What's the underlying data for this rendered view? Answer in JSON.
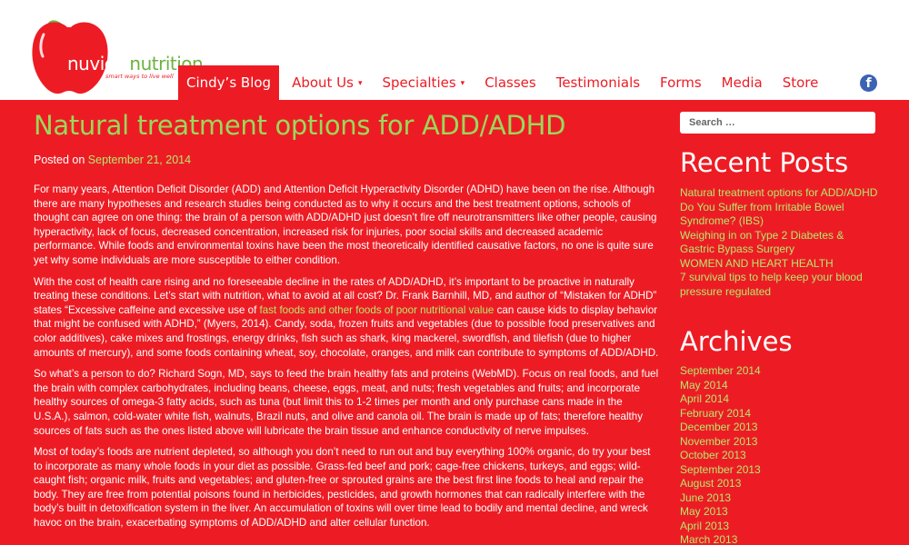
{
  "logo": {
    "word_white": "nuview",
    "word_green": "nutrition",
    "tagline": "smart ways to live well"
  },
  "nav": {
    "items": [
      {
        "label": "Cindy’s Blog",
        "dropdown": false,
        "active": true
      },
      {
        "label": "About Us",
        "dropdown": true,
        "active": false
      },
      {
        "label": "Specialties",
        "dropdown": true,
        "active": false
      },
      {
        "label": "Classes",
        "dropdown": false,
        "active": false
      },
      {
        "label": "Testimonials",
        "dropdown": false,
        "active": false
      },
      {
        "label": "Forms",
        "dropdown": false,
        "active": false
      },
      {
        "label": "Media",
        "dropdown": false,
        "active": false
      },
      {
        "label": "Store",
        "dropdown": false,
        "active": false
      }
    ],
    "caret": "▾",
    "social_icon": "facebook-icon",
    "social_glyph": "f"
  },
  "colors": {
    "brand_red": "#ed1c24",
    "brand_green": "#6cb33f",
    "title_green": "#9bd85a",
    "link_green": "#b5e86e",
    "facebook_blue": "#3b63b3"
  },
  "article": {
    "title": "Natural treatment options for ADD/ADHD",
    "posted_on_label": "Posted on",
    "posted_date": "September 21, 2014",
    "p1": "For many years, Attention Deficit Disorder (ADD) and Attention Deficit Hyperactivity Disorder (ADHD) have been on the rise. Although there are many hypotheses and research studies being conducted as to why it occurs and the best treatment options, schools of thought can agree on one thing: the brain of a person with ADD/ADHD just doesn’t fire off neurotransmitters like other people, causing hyperactivity, lack of focus, decreased concentration, increased risk for injuries, poor social skills and decreased academic performance.  While foods and environmental toxins have been the most theoretically identified causative factors, no one is quite sure yet why some individuals are more susceptible to either condition.",
    "p2_before_link": "With the cost of health care rising and no foreseeable decline in the rates of ADD/ADHD, it’s important to be proactive in naturally treating these conditions. Let’s start with nutrition, what to avoid at all cost?  Dr. Frank Barnhill, MD, and author of “Mistaken for ADHD” states “Excessive caffeine and excessive use of ",
    "p2_link": "fast foods and other foods of poor nutritional value",
    "p2_after_link": " can cause kids to display behavior that might be confused with ADHD,” (Myers, 2014). Candy, soda, frozen fruits and vegetables (due to possible food preservatives and color additives), cake mixes and frostings, energy drinks, fish such as shark, king mackerel, swordfish, and tilefish (due to higher amounts of mercury), and some foods containing wheat, soy, chocolate, oranges, and milk can contribute to symptoms of ADD/ADHD.",
    "p3": "So what’s a person to do? Richard Sogn, MD, says to feed the brain healthy fats and proteins (WebMD). Focus on real foods, and fuel the brain with complex carbohydrates, including beans, cheese, eggs, meat, and nuts; fresh vegetables and fruits; and incorporate healthy sources of omega-3 fatty acids, such as tuna (but limit this to 1-2 times per month and only purchase cans made in the U.S.A.), salmon, cold-water white fish, walnuts, Brazil nuts, and olive and canola oil. The brain is made up of fats; therefore healthy sources of fats such as the ones listed above will lubricate the brain tissue and enhance conductivity of nerve impulses.",
    "p4": "Most of today’s foods are nutrient depleted, so although you don’t need to run out and buy everything 100% organic, do try your best to incorporate as many whole foods in your diet as possible. Grass-fed beef and pork; cage-free chickens, turkeys, and eggs; wild-caught fish; organic milk, fruits and vegetables; and gluten-free or sprouted grains are the best first line foods to heal and repair the body. They are free from potential poisons found in herbicides, pesticides, and growth hormones that can radically interfere with the body’s built in detoxification system in the liver. An accumulation of toxins will over time lead to bodily and mental decline, and wreck havoc on the brain, exacerbating symptoms of ADD/ADHD and alter cellular function."
  },
  "sidebar": {
    "search_placeholder": "Search …",
    "recent_title": "Recent Posts",
    "recent_posts": [
      "Natural treatment options for ADD/ADHD",
      "Do You Suffer from Irritable Bowel Syndrome? (IBS)",
      "Weighing in on Type 2 Diabetes & Gastric Bypass Surgery",
      "WOMEN AND HEART HEALTH",
      "7 survival tips to help keep your blood pressure regulated"
    ],
    "archives_title": "Archives",
    "archives": [
      "September 2014",
      "May 2014",
      "April 2014",
      "February 2014",
      "December 2013",
      "November 2013",
      "October 2013",
      "September 2013",
      "August 2013",
      "June 2013",
      "May 2013",
      "April 2013",
      "March 2013"
    ]
  }
}
